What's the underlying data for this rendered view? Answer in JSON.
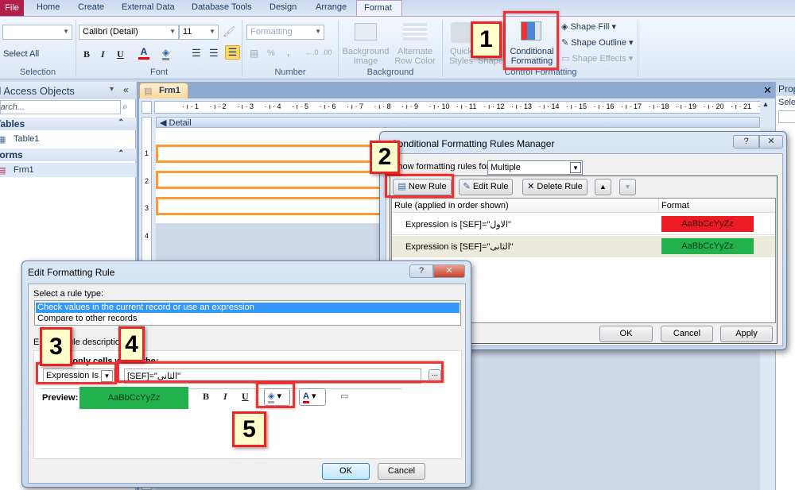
{
  "ribbon": {
    "tabs": [
      "File",
      "Home",
      "Create",
      "External Data",
      "Database Tools",
      "Design",
      "Arrange",
      "Format"
    ],
    "active_tab": "Format",
    "object_combo": "",
    "select_all": "Select All",
    "font_name": "Calibri (Detail)",
    "font_size": "11",
    "number_format": "Formatting",
    "background_image": "Background Image",
    "alternate_row_color": "Alternate Row Color",
    "quick_styles": "Quick Styles",
    "change_shape": "Shape",
    "conditional_formatting": "Conditional Formatting",
    "shape_fill": "Shape Fill",
    "shape_outline": "Shape Outline",
    "shape_effects": "Shape Effects",
    "groups": {
      "selection": "Selection",
      "font": "Font",
      "number": "Number",
      "background": "Background",
      "control_formatting": "Control Formatting"
    },
    "percent": "%",
    "comma": ","
  },
  "nav": {
    "title": "All Access Objects",
    "search_placeholder": "Search...",
    "sections": [
      {
        "label": "Tables",
        "items": [
          "Table1"
        ]
      },
      {
        "label": "Forms",
        "items": [
          "Frm1"
        ]
      }
    ]
  },
  "document": {
    "tab": "Frm1",
    "section": "Detail",
    "ruler_h": [
      "1",
      "2",
      "3",
      "4",
      "5",
      "6",
      "7",
      "8",
      "9",
      "10",
      "11",
      "12",
      "13",
      "14",
      "15",
      "16",
      "17",
      "18",
      "19",
      "20",
      "21",
      "22"
    ],
    "ruler_v": [
      "1",
      "2",
      "3",
      "4"
    ]
  },
  "property_sheet": {
    "title": "Prop",
    "selection": "Sele"
  },
  "rules_manager": {
    "title": "Conditional Formatting Rules Manager",
    "show_for_label": "Show formatting rules for:",
    "show_for_value": "Multiple",
    "new_rule": "New Rule",
    "edit_rule": "Edit Rule",
    "delete_rule": "Delete Rule",
    "col_rule": "Rule (applied in order shown)",
    "col_format": "Format",
    "rules": [
      {
        "rule": "Expression is [SEF]=\"الاول\"",
        "sample": "AaBbCcYyZz",
        "color": "#ed1c24"
      },
      {
        "rule": "Expression is [SEF]=\"الثانى\"",
        "sample": "AaBbCcYyZz",
        "color": "#22b14c"
      }
    ],
    "ok": "OK",
    "cancel": "Cancel",
    "apply": "Apply",
    "help": "?",
    "close": "✕"
  },
  "edit_rule": {
    "title": "Edit Formatting Rule",
    "select_type_label": "Select a rule type:",
    "rule_types": [
      "Check values in the current record or use an expression",
      "Compare to other records"
    ],
    "selected_type": 0,
    "edit_desc_label": "Edit the rule description:",
    "format_only_label": "Format only cells where the:",
    "condition": "Expression Is",
    "expression": "[SEF]=\"الثانى\"",
    "builder": "...",
    "preview_label": "Preview:",
    "preview_sample": "AaBbCcYyZz",
    "preview_color": "#22b14c",
    "bold": "B",
    "italic": "I",
    "underline": "U",
    "ok": "OK",
    "cancel": "Cancel",
    "help": "?",
    "close": "✕"
  },
  "callouts": [
    "1",
    "2",
    "3",
    "4",
    "5"
  ],
  "colors": {
    "highlight": "#e33333",
    "callout_bg": "#ffffcc",
    "control_border": "#ff9933",
    "selection": "#3399ff"
  }
}
